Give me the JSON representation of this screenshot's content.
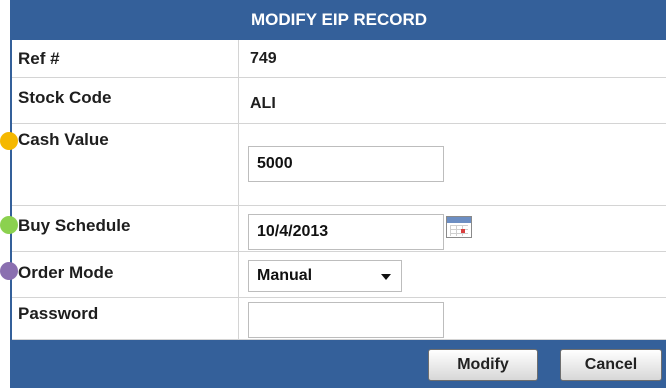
{
  "form": {
    "title": "MODIFY EIP RECORD",
    "fields": {
      "ref": {
        "label": "Ref #",
        "value": "749"
      },
      "stock_code": {
        "label": "Stock Code",
        "value": "ALI"
      },
      "cash_value": {
        "label": "Cash Value",
        "value": "5000"
      },
      "buy_schedule": {
        "label": "Buy Schedule",
        "value": "10/4/2013"
      },
      "order_mode": {
        "label": "Order Mode",
        "value": "Manual"
      },
      "password": {
        "label": "Password",
        "value": ""
      }
    },
    "buttons": {
      "modify": "Modify",
      "cancel": "Cancel"
    }
  },
  "markers": {
    "cash_value": "#f5b800",
    "buy_schedule": "#8bd14f",
    "order_mode": "#8a6fb0"
  },
  "colors": {
    "header": "#34609a",
    "border": "#d4d4d4"
  },
  "icons": {
    "calendar": "calendar-icon",
    "dropdown": "chevron-down-icon"
  }
}
